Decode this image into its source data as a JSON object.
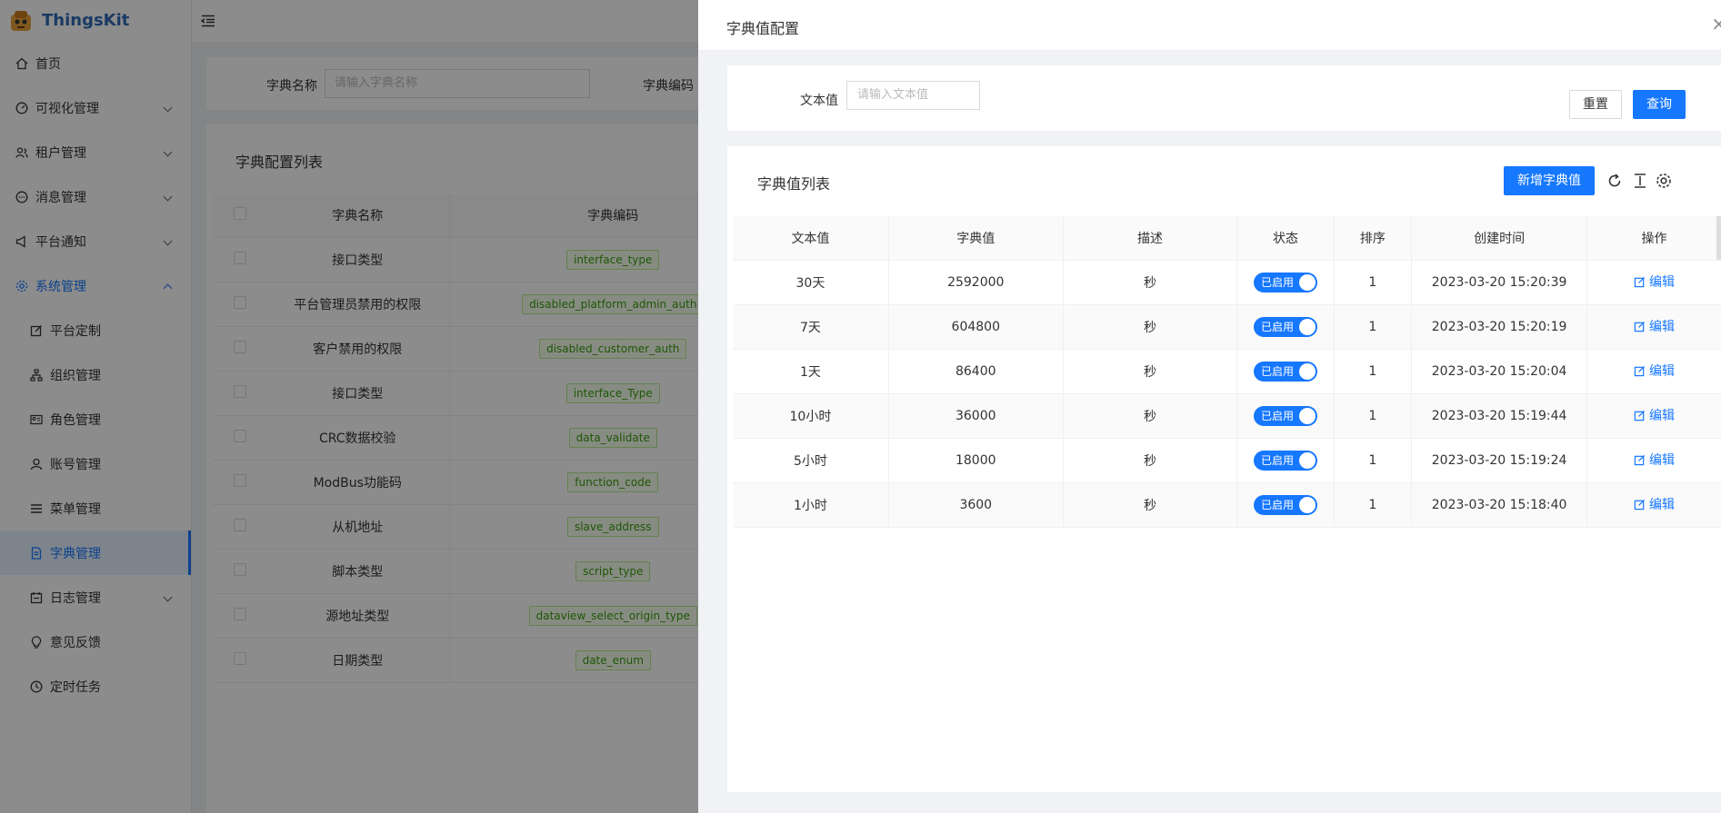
{
  "app": {
    "logo_text": "ThingsKit"
  },
  "sidebar": {
    "items": [
      {
        "label": "首页",
        "icon": "home-icon"
      },
      {
        "label": "可视化管理",
        "icon": "dashboard-icon"
      },
      {
        "label": "租户管理",
        "icon": "users-icon"
      },
      {
        "label": "消息管理",
        "icon": "message-icon"
      },
      {
        "label": "平台通知",
        "icon": "notification-icon"
      },
      {
        "label": "系统管理",
        "icon": "gear-icon"
      },
      {
        "label": "平台定制",
        "icon": "edit-icon"
      },
      {
        "label": "组织管理",
        "icon": "org-icon"
      },
      {
        "label": "角色管理",
        "icon": "role-icon"
      },
      {
        "label": "账号管理",
        "icon": "user-icon"
      },
      {
        "label": "菜单管理",
        "icon": "menu-icon"
      },
      {
        "label": "字典管理",
        "icon": "file-icon"
      },
      {
        "label": "日志管理",
        "icon": "calendar-icon"
      },
      {
        "label": "意见反馈",
        "icon": "bulb-icon"
      },
      {
        "label": "定时任务",
        "icon": "clock-icon"
      }
    ]
  },
  "background": {
    "search": {
      "name_label": "字典名称",
      "name_placeholder": "请输入字典名称",
      "code_label": "字典编码"
    },
    "list_title": "字典配置列表",
    "columns": [
      "字典名称",
      "字典编码"
    ],
    "rows": [
      {
        "name": "接口类型",
        "code": "interface_type"
      },
      {
        "name": "平台管理员禁用的权限",
        "code": "disabled_platform_admin_auth"
      },
      {
        "name": "客户禁用的权限",
        "code": "disabled_customer_auth"
      },
      {
        "name": "接口类型",
        "code": "interface_Type"
      },
      {
        "name": "CRC数据校验",
        "code": "data_validate"
      },
      {
        "name": "ModBus功能码",
        "code": "function_code"
      },
      {
        "name": "从机地址",
        "code": "slave_address"
      },
      {
        "name": "脚本类型",
        "code": "script_type"
      },
      {
        "name": "源地址类型",
        "code": "dataview_select_origin_type"
      },
      {
        "name": "日期类型",
        "code": "date_enum"
      }
    ]
  },
  "drawer": {
    "title": "字典值配置",
    "close": "×",
    "search": {
      "label": "文本值",
      "placeholder": "请输入文本值",
      "reset": "重置",
      "query": "查询"
    },
    "list_title": "字典值列表",
    "add_button": "新增字典值",
    "tools": [
      "reload-icon",
      "column-height-icon",
      "settings-icon"
    ],
    "columns": [
      "文本值",
      "字典值",
      "描述",
      "状态",
      "排序",
      "创建时间",
      "操作"
    ],
    "rows": [
      {
        "text": "30天",
        "value": "2592000",
        "desc": "秒",
        "status": "已启用",
        "sort": "1",
        "created": "2023-03-20 15:20:39",
        "action": "编辑"
      },
      {
        "text": "7天",
        "value": "604800",
        "desc": "秒",
        "status": "已启用",
        "sort": "1",
        "created": "2023-03-20 15:20:19",
        "action": "编辑"
      },
      {
        "text": "1天",
        "value": "86400",
        "desc": "秒",
        "status": "已启用",
        "sort": "1",
        "created": "2023-03-20 15:20:04",
        "action": "编辑"
      },
      {
        "text": "10小时",
        "value": "36000",
        "desc": "秒",
        "status": "已启用",
        "sort": "1",
        "created": "2023-03-20 15:19:44",
        "action": "编辑"
      },
      {
        "text": "5小时",
        "value": "18000",
        "desc": "秒",
        "status": "已启用",
        "sort": "1",
        "created": "2023-03-20 15:19:24",
        "action": "编辑"
      },
      {
        "text": "1小时",
        "value": "3600",
        "desc": "秒",
        "status": "已启用",
        "sort": "1",
        "created": "2023-03-20 15:18:40",
        "action": "编辑"
      }
    ]
  },
  "colors": {
    "primary": "#1677ff",
    "tag_green": "#389e0d",
    "mask": "rgba(0,0,0,0.45)"
  }
}
